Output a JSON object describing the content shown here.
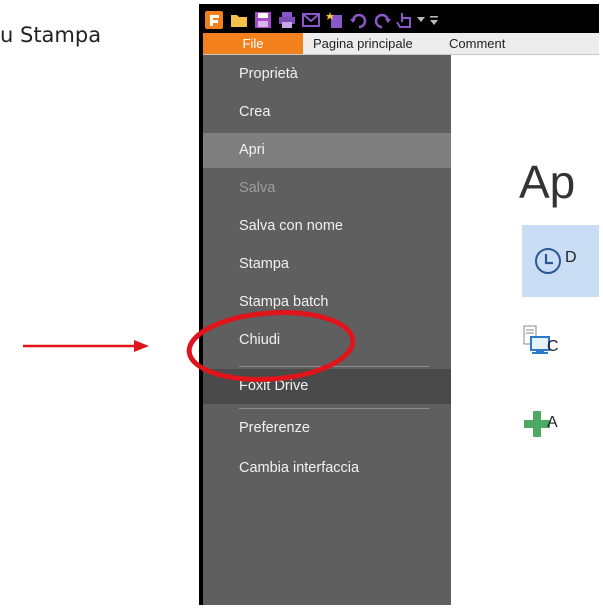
{
  "caption": "u Stampa",
  "tabs": {
    "file": "File",
    "home": "Pagina principale",
    "comment": "Comment"
  },
  "menu": {
    "items": [
      {
        "label": "Proprietà"
      },
      {
        "label": "Crea"
      },
      {
        "label": "Apri",
        "state": "active"
      },
      {
        "label": "Salva",
        "state": "disabled"
      },
      {
        "label": "Salva con nome"
      },
      {
        "label": "Stampa",
        "state": "circled"
      },
      {
        "label": "Stampa batch"
      },
      {
        "label": "Chiudi"
      },
      {
        "label": "Foxit Drive",
        "state": "highlighted"
      },
      {
        "label": "Preferenze"
      },
      {
        "label": "Cambia interfaccia"
      }
    ]
  },
  "content": {
    "title": "Ap",
    "recent_label": "D",
    "computer_label": "C",
    "add_label": "A"
  },
  "colors": {
    "file_tab": "#f2811d",
    "sidebar": "#5f5f5f",
    "active_item": "#7f7f7f",
    "recent_bg": "#c9ddf5",
    "annotation_red": "#e0141b",
    "add_green": "#4daa62"
  },
  "icons": [
    "foxit-logo-icon",
    "open-folder-icon",
    "save-icon",
    "print-icon",
    "email-icon",
    "new-icon",
    "undo-icon",
    "redo-icon",
    "hand-tool-icon",
    "customize-dropdown-icon",
    "clock-icon",
    "computer-icon",
    "plus-icon",
    "red-arrow",
    "red-circle"
  ]
}
